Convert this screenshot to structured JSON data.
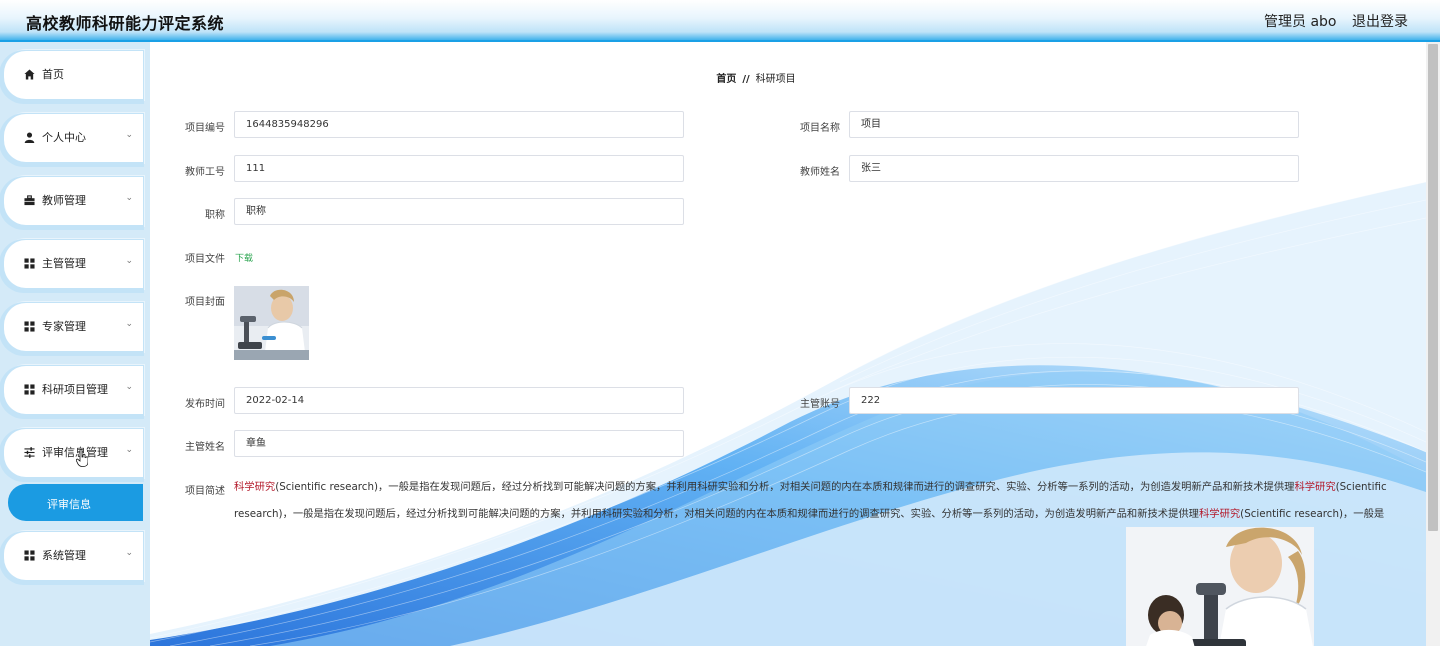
{
  "header": {
    "title": "高校教师科研能力评定系统",
    "user": "管理员 abo",
    "logout": "退出登录"
  },
  "sidebar": {
    "items": [
      {
        "label": "首页",
        "icon": "home-icon",
        "has_children": false
      },
      {
        "label": "个人中心",
        "icon": "user-icon",
        "has_children": true
      },
      {
        "label": "教师管理",
        "icon": "briefcase-icon",
        "has_children": true
      },
      {
        "label": "主管管理",
        "icon": "grid-icon",
        "has_children": true
      },
      {
        "label": "专家管理",
        "icon": "grid-icon",
        "has_children": true
      },
      {
        "label": "科研项目管理",
        "icon": "grid-icon",
        "has_children": true
      },
      {
        "label": "评审信息管理",
        "icon": "sliders-icon",
        "has_children": true
      },
      {
        "label": "系统管理",
        "icon": "grid-icon",
        "has_children": true
      }
    ],
    "active_sub": "评审信息"
  },
  "breadcrumb": {
    "home": "首页",
    "separator": "//",
    "current": "科研项目"
  },
  "form": {
    "project_no": {
      "label": "项目编号",
      "value": "1644835948296"
    },
    "project_name": {
      "label": "项目名称",
      "value": "项目"
    },
    "teacher_id": {
      "label": "教师工号",
      "value": "111"
    },
    "teacher_name": {
      "label": "教师姓名",
      "value": "张三"
    },
    "title": {
      "label": "职称",
      "value": "职称"
    },
    "file": {
      "label": "项目文件",
      "link": "下载"
    },
    "cover": {
      "label": "项目封面"
    },
    "publish_time": {
      "label": "发布时间",
      "value": "2022-02-14"
    },
    "supervisor_account": {
      "label": "主管账号",
      "value": "222"
    },
    "supervisor_name": {
      "label": "主管姓名",
      "value": "章鱼"
    },
    "summary": {
      "label": "项目简述",
      "highlight": "科学研究",
      "text_a": "(Scientific research)，一般是指在发现问题后，经过分析找到可能解决问题的方案，并利用科研实验和分析，对相关问题的内在本质和规律而进行的调查研究、实验、分析等一系列的活动，为创造发明新产品和新技术提供理",
      "text_b": "(Scientific research)，一般是指在发现问题后，经过分析找到可能解决问题的方案，并利用科研实验和分析，对相关问题的内在本质和规律而进行的调查研究、实验、分析等一系列的活动，为创造发明新产品和新技术提供理",
      "text_c": "(Scientific research)，一般是"
    }
  },
  "colors": {
    "accent": "#1b9be2",
    "highlight": "#b3192a",
    "link": "#2aa44f"
  }
}
